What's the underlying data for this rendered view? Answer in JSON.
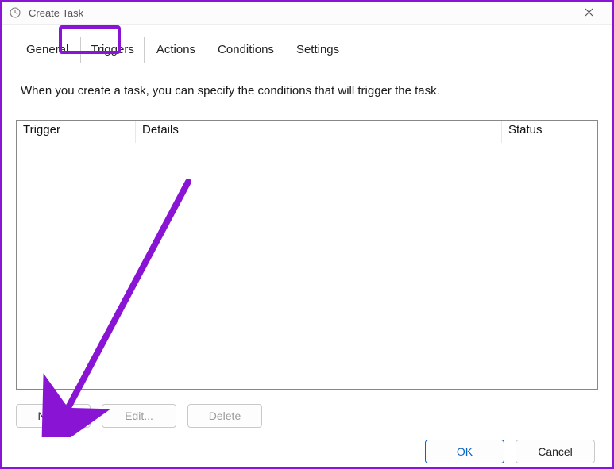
{
  "window": {
    "title": "Create Task"
  },
  "tabs": {
    "general": "General",
    "triggers": "Triggers",
    "actions": "Actions",
    "conditions": "Conditions",
    "settings": "Settings",
    "active": "triggers"
  },
  "description": "When you create a task, you can specify the conditions that will trigger the task.",
  "columns": {
    "trigger": "Trigger",
    "details": "Details",
    "status": "Status"
  },
  "buttons": {
    "new": "New...",
    "edit": "Edit...",
    "delete": "Delete",
    "ok": "OK",
    "cancel": "Cancel"
  },
  "annotation": {
    "highlight_tab": "triggers",
    "arrow_color": "#8a14d4"
  }
}
